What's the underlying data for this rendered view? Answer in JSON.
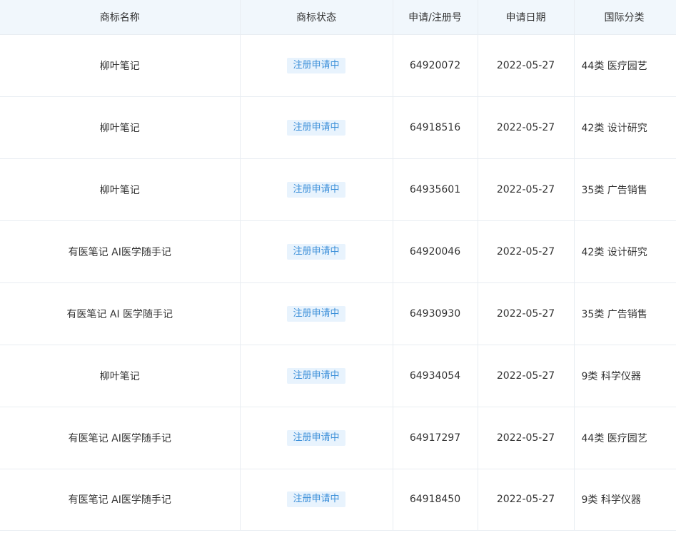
{
  "columns": {
    "name": "商标名称",
    "status": "商标状态",
    "number": "申请/注册号",
    "date": "申请日期",
    "class": "国际分类"
  },
  "rows": [
    {
      "name": "柳叶笔记",
      "status": "注册申请中",
      "number": "64920072",
      "date": "2022-05-27",
      "class": "44类 医疗园艺"
    },
    {
      "name": "柳叶笔记",
      "status": "注册申请中",
      "number": "64918516",
      "date": "2022-05-27",
      "class": "42类 设计研究"
    },
    {
      "name": "柳叶笔记",
      "status": "注册申请中",
      "number": "64935601",
      "date": "2022-05-27",
      "class": "35类 广告销售"
    },
    {
      "name": "有医笔记 AI医学随手记",
      "status": "注册申请中",
      "number": "64920046",
      "date": "2022-05-27",
      "class": "42类 设计研究"
    },
    {
      "name": "有医笔记 AI 医学随手记",
      "status": "注册申请中",
      "number": "64930930",
      "date": "2022-05-27",
      "class": "35类 广告销售"
    },
    {
      "name": "柳叶笔记",
      "status": "注册申请中",
      "number": "64934054",
      "date": "2022-05-27",
      "class": "9类 科学仪器"
    },
    {
      "name": "有医笔记 AI医学随手记",
      "status": "注册申请中",
      "number": "64917297",
      "date": "2022-05-27",
      "class": "44类 医疗园艺"
    },
    {
      "name": "有医笔记 AI医学随手记",
      "status": "注册申请中",
      "number": "64918450",
      "date": "2022-05-27",
      "class": "9类 科学仪器"
    }
  ],
  "colors": {
    "header_bg": "#f1f7fc",
    "badge_bg": "#e8f3fd",
    "badge_text": "#3b8fd9",
    "border": "#e8edf2"
  }
}
